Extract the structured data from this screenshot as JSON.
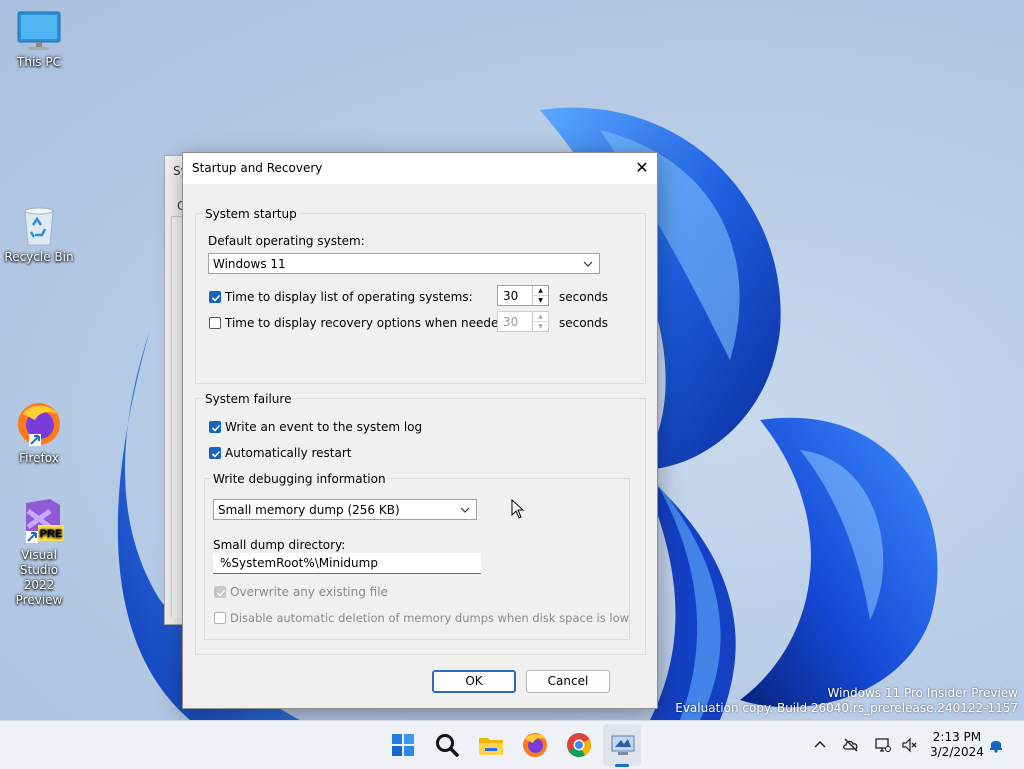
{
  "desktop": {
    "icons": [
      {
        "label": "This PC"
      },
      {
        "label": "Recycle Bin"
      },
      {
        "label": "Firefox"
      },
      {
        "label_line1": "Visual Studio",
        "label_line2": "2022 Preview",
        "badge": "PRE"
      }
    ]
  },
  "back_window": {
    "title_fragment": "Sy",
    "tab_fragment": "C"
  },
  "dialog": {
    "title": "Startup and Recovery",
    "close_glyph": "✕",
    "system_startup": {
      "group_label": "System startup",
      "default_os_label": "Default operating system:",
      "default_os_value": "Windows 11",
      "display_list": {
        "label": "Time to display list of operating systems:",
        "checked": true,
        "value": "30",
        "unit": "seconds"
      },
      "display_recovery": {
        "label": "Time to display recovery options when needed:",
        "checked": false,
        "value": "30",
        "unit": "seconds"
      }
    },
    "system_failure": {
      "group_label": "System failure",
      "write_event": {
        "label": "Write an event to the system log",
        "checked": true
      },
      "auto_restart": {
        "label": "Automatically restart",
        "checked": true
      },
      "debug_group_label": "Write debugging information",
      "debug_type_value": "Small memory dump (256 KB)",
      "dump_dir_label": "Small dump directory:",
      "dump_dir_value": "%SystemRoot%\\Minidump",
      "overwrite": {
        "label": "Overwrite any existing file",
        "checked": true,
        "disabled": true
      },
      "disable_auto_delete": {
        "label": "Disable automatic deletion of memory dumps when disk space is low",
        "checked": false,
        "disabled": true
      }
    },
    "ok_label": "OK",
    "cancel_label": "Cancel"
  },
  "watermark": {
    "line1": "Windows 11 Pro Insider Preview",
    "line2": "Evaluation copy. Build 26040.rs_prerelease.240122-1157"
  },
  "taskbar": {
    "apps": [
      "start-icon",
      "search-icon",
      "file-explorer-icon",
      "firefox-icon",
      "chrome-icon",
      "system-properties-icon"
    ],
    "tray": [
      "chevron-up-icon",
      "onedrive-offline-icon",
      "network-icon",
      "volume-muted-icon",
      "notification-bell-icon"
    ],
    "time": "2:13 PM",
    "date": "3/2/2024"
  },
  "colors": {
    "accent": "#1565c0",
    "taskbar_bg": "#eef1f6",
    "dialog_bg": "#f0f0f0"
  }
}
